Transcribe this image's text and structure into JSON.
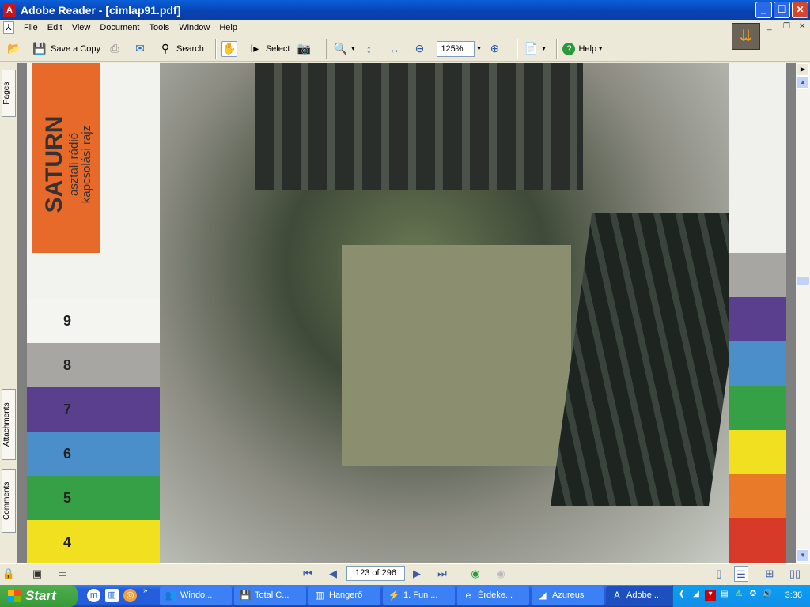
{
  "window": {
    "title": "Adobe Reader - [cimlap91.pdf]"
  },
  "menu": [
    "File",
    "Edit",
    "View",
    "Document",
    "Tools",
    "Window",
    "Help"
  ],
  "toolbar": {
    "save_copy": "Save a Copy",
    "search": "Search",
    "select": "Select",
    "zoom": "125%",
    "help": "Help"
  },
  "side_tabs": {
    "pages": "Pages",
    "attachments": "Attachments",
    "comments": "Comments"
  },
  "document": {
    "title": "SATURN",
    "subtitle1": "asztali rádió",
    "subtitle2": "kapcsolási rajz",
    "bands": [
      {
        "num": "9",
        "color": "#f4f4f0"
      },
      {
        "num": "8",
        "color": "#a8a6a2"
      },
      {
        "num": "7",
        "color": "#5b3f8f"
      },
      {
        "num": "6",
        "color": "#4a8fca"
      },
      {
        "num": "5",
        "color": "#36a046"
      },
      {
        "num": "4",
        "color": "#f0e020"
      }
    ],
    "right_bands": [
      "#a8a6a2",
      "#5b3f8f",
      "#4a8fca",
      "#36a046",
      "#f0e020",
      "#e87a2a",
      "#d83a2a"
    ]
  },
  "status": {
    "page": "123 of 296"
  },
  "taskbar": {
    "start": "Start",
    "tasks": [
      {
        "label": "Windo...",
        "icon": "windows-messenger-icon"
      },
      {
        "label": "Total C...",
        "icon": "floppy-icon"
      },
      {
        "label": "Hangerő",
        "icon": "volume-icon"
      },
      {
        "label": "1. Fun ...",
        "icon": "winamp-icon"
      },
      {
        "label": "Érdeke...",
        "icon": "ie-icon"
      },
      {
        "label": "Azureus",
        "icon": "azureus-icon"
      },
      {
        "label": "Adobe ...",
        "icon": "adobe-icon",
        "active": true
      }
    ],
    "clock": "3:36"
  }
}
